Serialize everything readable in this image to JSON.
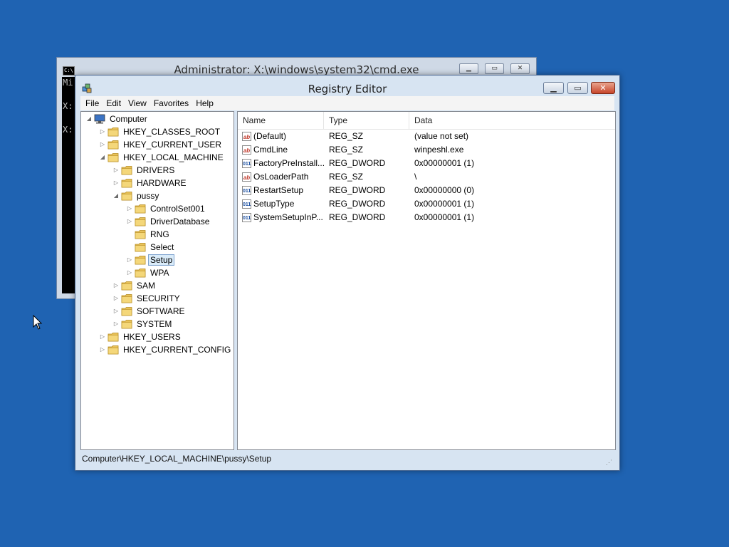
{
  "cmd": {
    "title": "Administrator: X:\\windows\\system32\\cmd.exe",
    "icon_text": "C:\\",
    "lines": [
      "Mi",
      "X:",
      "X:"
    ]
  },
  "regedit": {
    "title": "Registry Editor",
    "menu": [
      "File",
      "Edit",
      "View",
      "Favorites",
      "Help"
    ],
    "tree": [
      {
        "label": "Computer",
        "depth": 0,
        "expander": "expanded",
        "icon": "computer"
      },
      {
        "label": "HKEY_CLASSES_ROOT",
        "depth": 1,
        "expander": "collapsed"
      },
      {
        "label": "HKEY_CURRENT_USER",
        "depth": 1,
        "expander": "collapsed"
      },
      {
        "label": "HKEY_LOCAL_MACHINE",
        "depth": 1,
        "expander": "expanded"
      },
      {
        "label": "DRIVERS",
        "depth": 2,
        "expander": "collapsed"
      },
      {
        "label": "HARDWARE",
        "depth": 2,
        "expander": "collapsed"
      },
      {
        "label": "pussy",
        "depth": 2,
        "expander": "expanded"
      },
      {
        "label": "ControlSet001",
        "depth": 3,
        "expander": "collapsed"
      },
      {
        "label": "DriverDatabase",
        "depth": 3,
        "expander": "collapsed"
      },
      {
        "label": "RNG",
        "depth": 3,
        "expander": "none"
      },
      {
        "label": "Select",
        "depth": 3,
        "expander": "none"
      },
      {
        "label": "Setup",
        "depth": 3,
        "expander": "collapsed",
        "selected": true
      },
      {
        "label": "WPA",
        "depth": 3,
        "expander": "collapsed"
      },
      {
        "label": "SAM",
        "depth": 2,
        "expander": "collapsed"
      },
      {
        "label": "SECURITY",
        "depth": 2,
        "expander": "collapsed"
      },
      {
        "label": "SOFTWARE",
        "depth": 2,
        "expander": "collapsed"
      },
      {
        "label": "SYSTEM",
        "depth": 2,
        "expander": "collapsed"
      },
      {
        "label": "HKEY_USERS",
        "depth": 1,
        "expander": "collapsed"
      },
      {
        "label": "HKEY_CURRENT_CONFIG",
        "depth": 1,
        "expander": "collapsed"
      }
    ],
    "columns": [
      "Name",
      "Type",
      "Data"
    ],
    "values": [
      {
        "name": "(Default)",
        "type": "REG_SZ",
        "data": "(value not set)",
        "icon": "string"
      },
      {
        "name": "CmdLine",
        "type": "REG_SZ",
        "data": "winpeshl.exe",
        "icon": "string"
      },
      {
        "name": "FactoryPreInstall...",
        "type": "REG_DWORD",
        "data": "0x00000001 (1)",
        "icon": "binary"
      },
      {
        "name": "OsLoaderPath",
        "type": "REG_SZ",
        "data": "\\",
        "icon": "string"
      },
      {
        "name": "RestartSetup",
        "type": "REG_DWORD",
        "data": "0x00000000 (0)",
        "icon": "binary"
      },
      {
        "name": "SetupType",
        "type": "REG_DWORD",
        "data": "0x00000001 (1)",
        "icon": "binary"
      },
      {
        "name": "SystemSetupInP...",
        "type": "REG_DWORD",
        "data": "0x00000001 (1)",
        "icon": "binary"
      }
    ],
    "status_path": "Computer\\HKEY_LOCAL_MACHINE\\pussy\\Setup"
  },
  "colors": {
    "desktop": "#1f63b2",
    "folder": "#e8c25a",
    "selection": "#d9ebf9",
    "close_button": "#c7452a"
  }
}
